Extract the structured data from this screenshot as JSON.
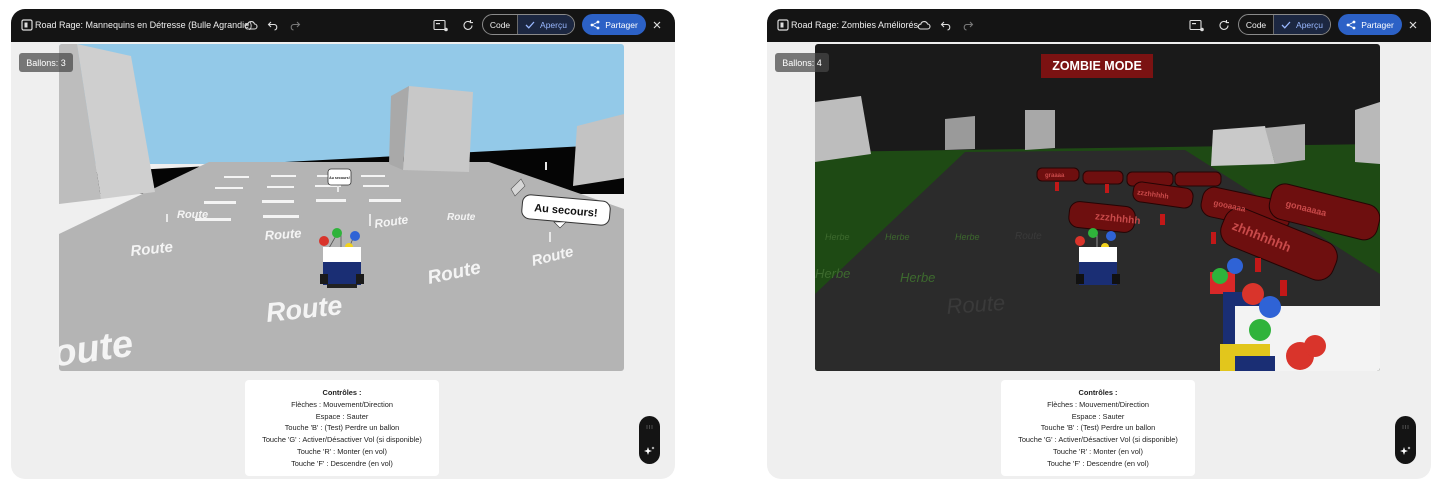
{
  "panels": [
    {
      "title": "Road Rage: Mannequins en Détresse (Bulle Agrandie)",
      "toolbar": {
        "code_label": "Code",
        "preview_label": "Aperçu",
        "share_label": "Partager"
      },
      "hud": {
        "balloons": "Ballons: 3"
      },
      "scene": {
        "road_labels": [
          "Route",
          "Route",
          "Route",
          "Route",
          "Route",
          "oute"
        ],
        "speech_bubble": "Au secours!",
        "small_sign": "Au secours!"
      },
      "controls": {
        "title": "Contrôles :",
        "lines": [
          "Flèches : Mouvement/Direction",
          "Espace : Sauter",
          "Touche 'B' : (Test) Perdre un ballon",
          "Touche 'G' : Activer/Désactiver Vol (si disponible)",
          "Touche 'R' : Monter (en vol)",
          "Touche 'F' : Descendre (en vol)"
        ]
      }
    },
    {
      "title": "Road Rage: Zombies Améliorés",
      "toolbar": {
        "code_label": "Code",
        "preview_label": "Aperçu",
        "share_label": "Partager"
      },
      "hud": {
        "balloons": "Ballons: 4",
        "mode_banner": "ZOMBIE MODE"
      },
      "scene": {
        "road_labels": [
          "Route",
          "Route"
        ],
        "grass_labels": [
          "Herbe",
          "Herbe",
          "Herbe",
          "Herbe",
          "Herbe"
        ],
        "zombie_bubbles": [
          "zzzhhhhh",
          "graaaa",
          "zzzhhhhh",
          "gooaaaa",
          "zhhhhhhh",
          "gonaaaaa"
        ]
      },
      "controls": {
        "title": "Contrôles :",
        "lines": [
          "Flèches : Mouvement/Direction",
          "Espace : Sauter",
          "Touche 'B' : (Test) Perdre un ballon",
          "Touche 'G' : Activer/Désactiver Vol (si disponible)",
          "Touche 'R' : Monter (en vol)",
          "Touche 'F' : Descendre (en vol)"
        ]
      }
    }
  ],
  "colors": {
    "topbar": "#141414",
    "share_button": "#2c61c6",
    "sky_day": "#93c9e8",
    "road_day": "#b4b4b4",
    "sky_night": "#1a1a1a",
    "grass_night": "#1e4a14",
    "zombie_banner": "#7b1212"
  },
  "icons": [
    "app-icon",
    "cloud-icon",
    "undo-icon",
    "redo-icon",
    "frame-icon",
    "reload-icon",
    "check-icon",
    "share-icon",
    "close-icon",
    "drag-handle-icon",
    "sparkle-icon"
  ]
}
